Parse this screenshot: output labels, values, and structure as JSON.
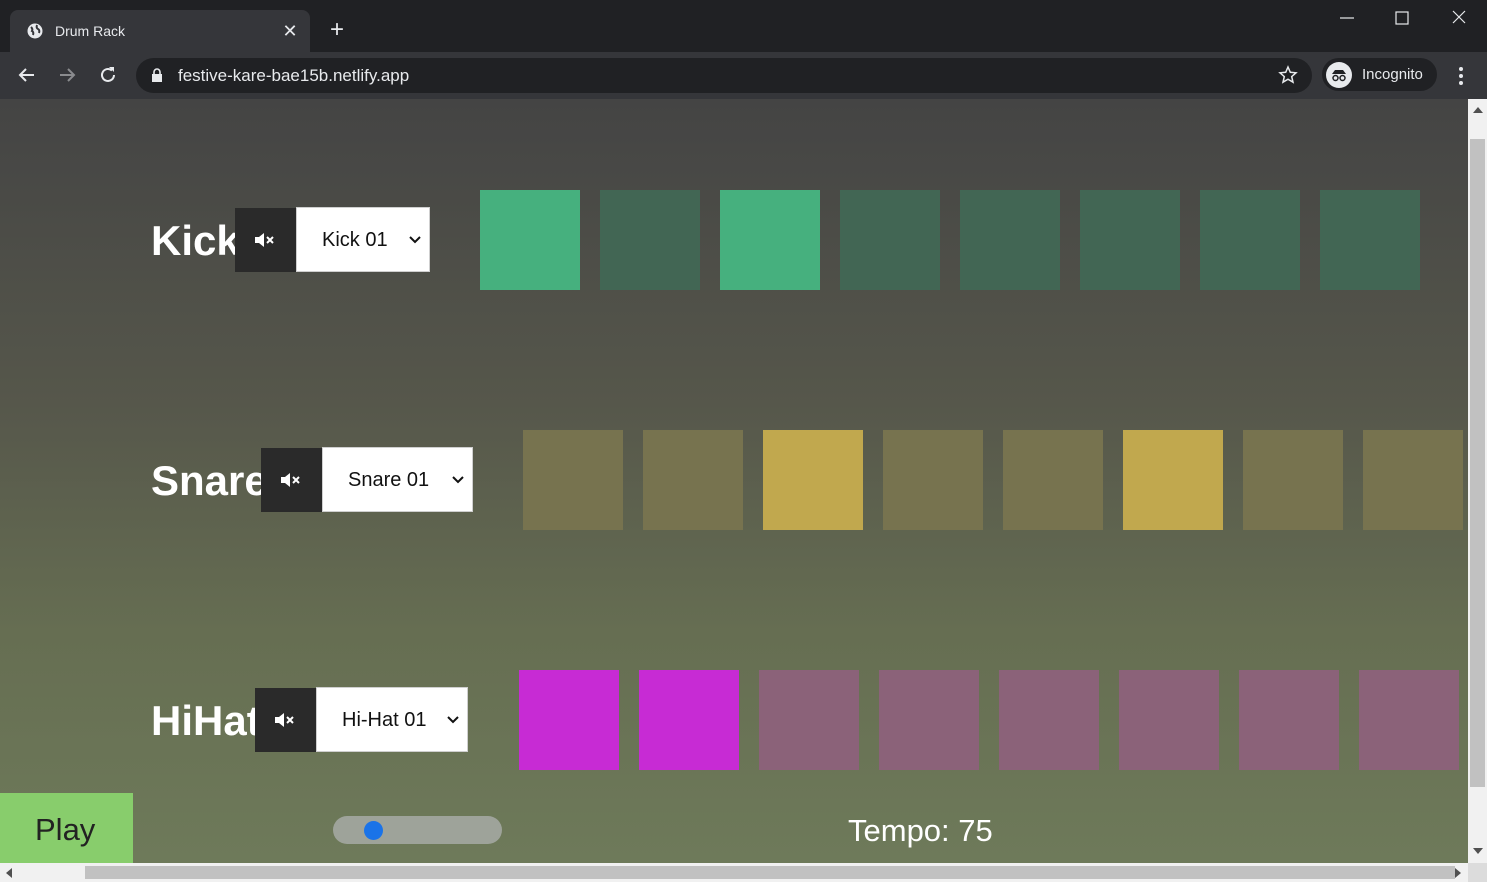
{
  "browser": {
    "tab_title": "Drum Rack",
    "tab_close": "✕",
    "new_tab": "+",
    "url": "festive-kare-bae15b.netlify.app",
    "incognito_label": "Incognito"
  },
  "tracks": [
    {
      "name": "Kick",
      "sample": "Kick 01",
      "on_color": "#46b07e",
      "off_color": "#426654",
      "steps": [
        true,
        false,
        true,
        false,
        false,
        false,
        false,
        false
      ]
    },
    {
      "name": "Snare",
      "sample": "Snare 01",
      "on_color": "#c1a84e",
      "off_color": "#77734f",
      "steps": [
        false,
        false,
        true,
        false,
        false,
        true,
        false,
        false
      ]
    },
    {
      "name": "HiHat",
      "sample": "Hi-Hat 01",
      "on_color": "#c72bd4",
      "off_color": "#8b6279",
      "steps": [
        true,
        true,
        false,
        false,
        false,
        false,
        false,
        false
      ]
    }
  ],
  "transport": {
    "play_label": "Play",
    "tempo_label": "Tempo: 75",
    "tempo_value": 75
  }
}
